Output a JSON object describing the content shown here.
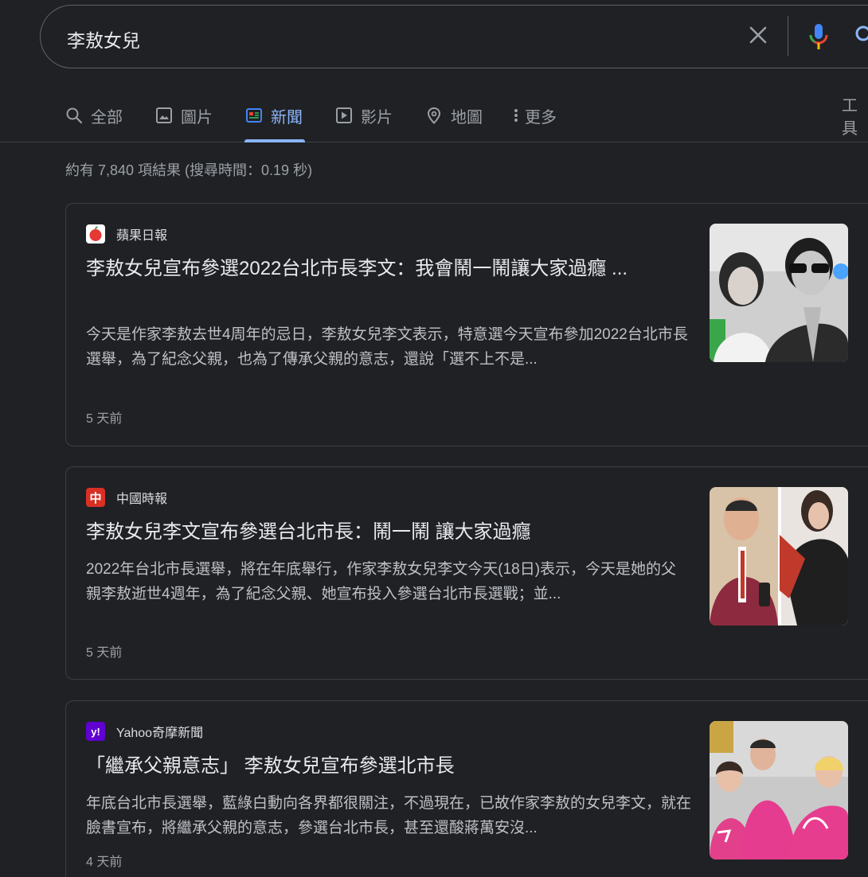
{
  "search": {
    "query": "李敖女兒"
  },
  "tabs": [
    {
      "label": "全部",
      "icon": "search-icon"
    },
    {
      "label": "圖片",
      "icon": "image-icon"
    },
    {
      "label": "新聞",
      "icon": "news-icon"
    },
    {
      "label": "影片",
      "icon": "play-icon"
    },
    {
      "label": "地圖",
      "icon": "map-pin-icon"
    },
    {
      "label": "更多",
      "icon": "more-vert-icon"
    },
    {
      "label": "工具"
    }
  ],
  "active_tab": "新聞",
  "stats": "約有 7,840 項結果 (搜尋時間：0.19 秒)",
  "colors": {
    "background": "#202124",
    "accent": "#8ab4f8",
    "title_text": "#e8eaed",
    "body_text": "#bdc1c6"
  },
  "results": [
    {
      "source": "蘋果日報",
      "favicon": "apple-icon",
      "headline": "李敖女兒宣布參選2022台北市長李文：我會鬧一鬧讓大家過癮 ...",
      "snippet": "今天是作家李敖去世4周年的忌日，李敖女兒李文表示，特意選今天宣布參加2022台北市長選舉，為了紀念父親，也為了傳承父親的意志，還說「選不上不是...",
      "age": "5 天前"
    },
    {
      "source": "中國時報",
      "favicon": "chinatimes-icon",
      "favicon_text": "中",
      "headline": "李敖女兒李文宣布參選台北市長：鬧一鬧 讓大家過癮",
      "snippet": "2022年台北市長選舉，將在年底舉行，作家李敖女兒李文今天(18日)表示，今天是她的父親李敖逝世4週年，為了紀念父親、她宣布投入參選台北市長選戰；並...",
      "age": "5 天前"
    },
    {
      "source": "Yahoo奇摩新聞",
      "favicon": "yahoo-icon",
      "favicon_text": "y!",
      "headline": "「繼承父親意志」 李敖女兒宣布參選北市長",
      "snippet": "年底台北市長選舉，藍綠白動向各界都很關注，不過現在，已故作家李敖的女兒李文，就在臉書宣布，將繼承父親的意志，參選台北市長，甚至還酸蔣萬安沒...",
      "age": "4 天前"
    }
  ]
}
